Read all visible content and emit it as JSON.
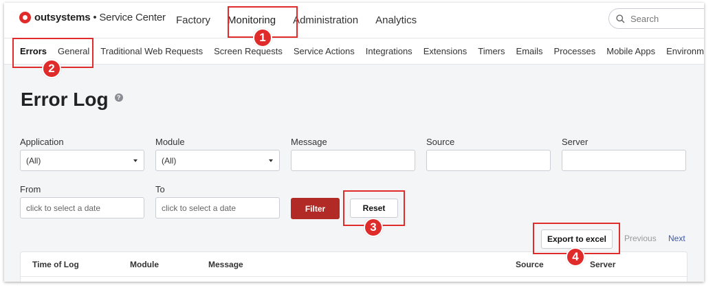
{
  "brand": {
    "name": "outsystems",
    "separator": "•",
    "product": "Service Center"
  },
  "topnav": {
    "items": [
      "Factory",
      "Monitoring",
      "Administration",
      "Analytics"
    ],
    "active": "Monitoring"
  },
  "search": {
    "placeholder": "Search"
  },
  "subnav": {
    "items": [
      "Errors",
      "General",
      "Traditional Web Requests",
      "Screen Requests",
      "Service Actions",
      "Integrations",
      "Extensions",
      "Timers",
      "Emails",
      "Processes",
      "Mobile Apps",
      "Environment He"
    ],
    "active": "Errors"
  },
  "page": {
    "title": "Error Log",
    "help_glyph": "?"
  },
  "filters": {
    "application": {
      "label": "Application",
      "value": "(All)"
    },
    "module": {
      "label": "Module",
      "value": "(All)"
    },
    "message": {
      "label": "Message",
      "value": ""
    },
    "source": {
      "label": "Source",
      "value": ""
    },
    "server": {
      "label": "Server",
      "value": ""
    },
    "from": {
      "label": "From",
      "placeholder": "click to select a date"
    },
    "to": {
      "label": "To",
      "placeholder": "click to select a date"
    },
    "filter_button": "Filter",
    "reset_button": "Reset"
  },
  "actions": {
    "export_button": "Export to excel"
  },
  "pager": {
    "previous": "Previous",
    "next": "Next"
  },
  "table": {
    "columns": [
      "Time of Log",
      "Module",
      "Message",
      "Source",
      "Server"
    ]
  },
  "annotations": {
    "badges": [
      "1",
      "2",
      "3",
      "4"
    ],
    "color": "#e02b2b"
  },
  "colors": {
    "brand_red": "#e02b2b",
    "filter_button": "#b22a25",
    "link_blue": "#3b57a6",
    "muted": "#999999"
  }
}
